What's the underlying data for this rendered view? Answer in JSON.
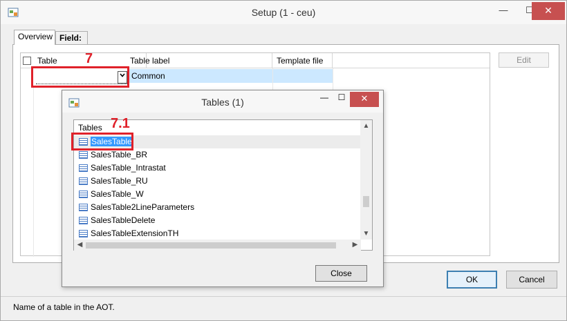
{
  "window": {
    "title": "Setup (1 - ceu)",
    "minimize": "—",
    "maximize": "☐",
    "close": "✕"
  },
  "tabs": [
    {
      "label": "Overview"
    },
    {
      "label": "Field:"
    }
  ],
  "grid": {
    "columns": [
      "Table",
      "Table label",
      "Template file"
    ],
    "row": {
      "table": "",
      "table_label": "Common",
      "template_file": ""
    }
  },
  "annotations": {
    "step1": "7",
    "step2": "7.1"
  },
  "buttons": {
    "edit": "Edit",
    "ok": "OK",
    "cancel": "Cancel"
  },
  "status": {
    "text": "Name of a table in the AOT."
  },
  "dialog": {
    "title": "Tables (1)",
    "minimize": "—",
    "maximize": "☐",
    "close": "✕",
    "list_header": "Tables",
    "items": [
      "SalesTable",
      "SalesTable_BR",
      "SalesTable_Intrastat",
      "SalesTable_RU",
      "SalesTable_W",
      "SalesTable2LineParameters",
      "SalesTableDelete",
      "SalesTableExtensionTH"
    ],
    "selected_index": 0,
    "close_button": "Close"
  },
  "colors": {
    "highlight_red": "#e0212a",
    "selection_blue": "#3399ff",
    "row_select": "#cce8ff"
  }
}
